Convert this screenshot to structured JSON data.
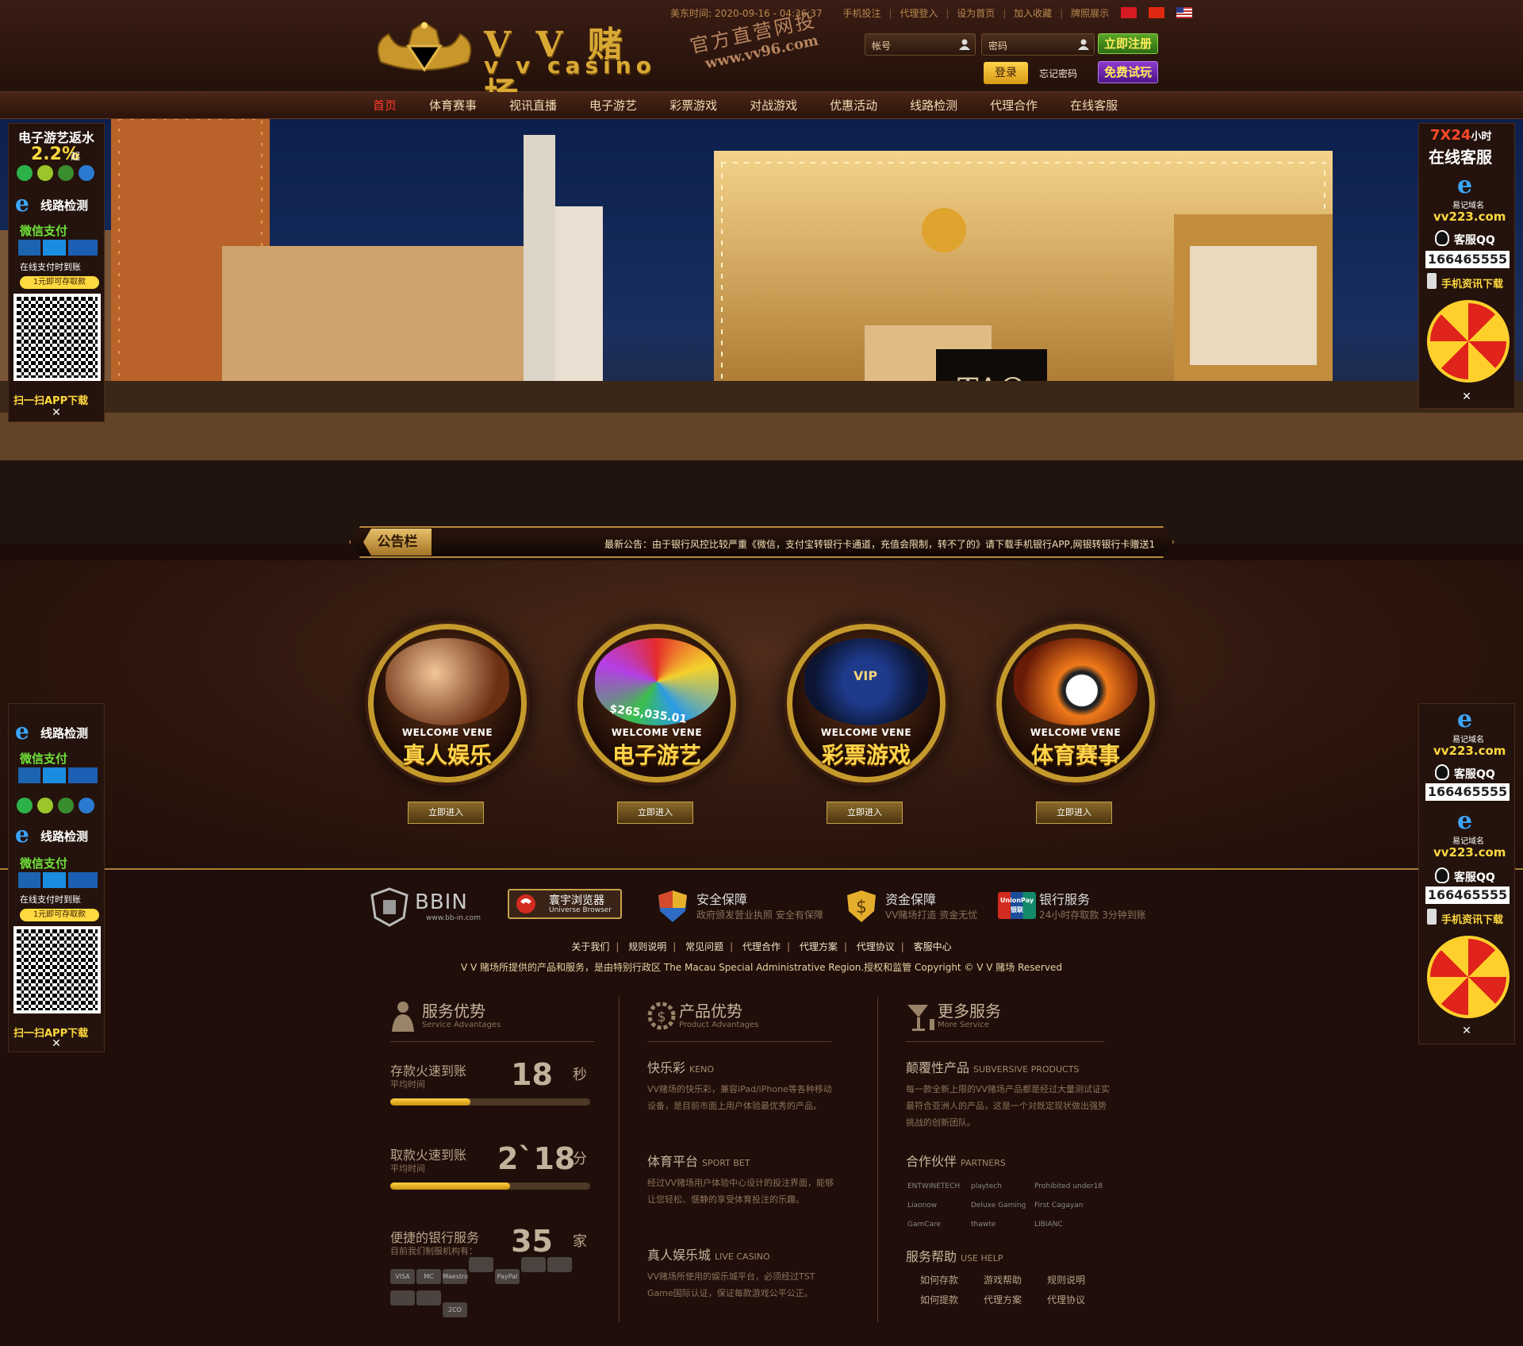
{
  "header": {
    "logo_title": "V V 赌场",
    "logo_sub": "v v casino",
    "slogan_1": "官方直营网投",
    "slogan_2": "www.vv96.com",
    "time_label": "美东时间:",
    "time_value": "2020-09-16 - 04:36:37",
    "top_links": [
      "手机投注",
      "代理登入",
      "设为首页",
      "加入收藏",
      "牌照展示"
    ],
    "account_placeholder": "帐号",
    "password_placeholder": "密码",
    "register_label": "立即注册",
    "login_label": "登录",
    "forgot_label": "忘记密码",
    "trial_label": "免费试玩"
  },
  "nav": {
    "items": [
      "首页",
      "体育赛事",
      "视讯直播",
      "电子游艺",
      "彩票游戏",
      "对战游戏",
      "优惠活动",
      "线路检测",
      "代理合作",
      "在线客服"
    ]
  },
  "banner": {
    "sign_text": "TAO"
  },
  "notice": {
    "label": "公告栏",
    "text": "最新公告：由于银行风控比较严重《微信，支付宝转银行卡通道，充值会限制，转不了的》请下载手机银行APP,网银转银行卡赠送1"
  },
  "games": [
    {
      "welcome": "WELCOME VENE",
      "title": "真人娱乐",
      "enter": "立即进入"
    },
    {
      "welcome": "WELCOME VENE",
      "title": "电子游艺",
      "enter": "立即进入",
      "art_text": "$265,035.01"
    },
    {
      "welcome": "WELCOME VENE",
      "title": "彩票游戏",
      "enter": "立即进入",
      "art_text": "VIP"
    },
    {
      "welcome": "WELCOME VENE",
      "title": "体育赛事",
      "enter": "立即进入"
    }
  ],
  "footer": {
    "bbin": {
      "name": "BBIN",
      "url": "www.bb-in.com"
    },
    "browser": {
      "title": "寰宇浏览器",
      "sub": "Universe Browser"
    },
    "features": [
      {
        "title": "安全保障",
        "desc": "政府颁发营业执照  安全有保障"
      },
      {
        "title": "资金保障",
        "desc": "VV赌场打造  资金无忧"
      },
      {
        "title": "银行服务",
        "desc": "24小时存取款  3分钟到账"
      }
    ],
    "unionpay_badge": "UnionPay 银联",
    "links": [
      "关于我们",
      "规则说明",
      "常见问题",
      "代理合作",
      "代理方案",
      "代理协议",
      "客服中心"
    ],
    "copyright": "V V 赌场所提供的产品和服务，是由特别行政区 The Macau Special Administrative Region.授权和监管 Copyright © V V 赌场 Reserved",
    "service": {
      "title": "服务优势",
      "sub": "Service Advantages",
      "stats": [
        {
          "title": "存款火速到账",
          "sub": "平均时间",
          "value": "18",
          "unit": "秒",
          "progress": 0.4
        },
        {
          "title": "取款火速到账",
          "sub": "平均时间",
          "value": "2`18",
          "unit": "分",
          "progress": 0.6
        },
        {
          "title": "便捷的银行服务",
          "sub": "目前我们制服机构有：",
          "value": "35",
          "unit": "家"
        }
      ],
      "payments": [
        "VISA",
        "MC",
        "Maestro",
        "",
        "PayPal",
        "",
        "",
        "",
        "",
        "2CO"
      ]
    },
    "product": {
      "title": "产品优势",
      "sub": "Product Advantages",
      "items": [
        {
          "title": "快乐彩",
          "en": "KENO",
          "desc": "VV赌场的快乐彩，兼容iPad/iPhone等各种移动设备，是目前市面上用户体验最优秀的产品。"
        },
        {
          "title": "体育平台",
          "en": "SPORT BET",
          "desc": "经过VV赌场用户体验中心设计的投注界面，能够让您轻松、惬静的享受体育投注的乐趣。"
        },
        {
          "title": "真人娱乐城",
          "en": "LIVE CASINO",
          "desc": "VV赌场所使用的娱乐城平台，必须经过TST Game国际认证，保证每款游戏公平公正。"
        }
      ]
    },
    "more": {
      "title": "更多服务",
      "sub": "More Service",
      "subversive": {
        "title": "颠覆性产品",
        "en": "SUBVERSIVE PRODUCTS",
        "desc": "每一款全新上限的VV赌场产品都是经过大量测试证实最符合亚洲人的产品，这是一个对既定现状做出强势挑战的创新团队。"
      },
      "partners_title": "合作伙伴",
      "partners_en": "PARTNERS",
      "partners": [
        "ENTWINETECH",
        "playtech",
        "Prohibited under18",
        "Liaonow",
        "Deluxe Gaming",
        "First Cagayan",
        "GamCare",
        "thawte",
        "LIBIANC"
      ],
      "help_title": "服务帮助",
      "help_en": "USE HELP",
      "help_links": [
        "如何存款",
        "游戏帮助",
        "规则说明",
        "如何提款",
        "代理方案",
        "代理协议"
      ]
    }
  },
  "left_float": {
    "rebate_title": "电子游艺返水",
    "rebate_rate": "2.2%",
    "rebate_suffix": "起",
    "line_check": "线路检测",
    "wechat_pay": "微信支付",
    "online_pay": "在线支付时到账",
    "min_deposit": "1元即可存取款",
    "scan_label": "扫一扫APP下载",
    "close": "✕"
  },
  "right_float": {
    "service_title_1": "7X24",
    "service_title_suffix": "小时",
    "service_title_2": "在线客服",
    "site_label": "易记域名",
    "site": "vv223.com",
    "qq_label": "客服QQ",
    "qq": "166465555",
    "mobile_download": "手机资讯下载",
    "close": "✕"
  },
  "colors": {
    "gold": "#d9a934",
    "nav_active": "#ff3b2b",
    "background": "#1c0d0a"
  }
}
